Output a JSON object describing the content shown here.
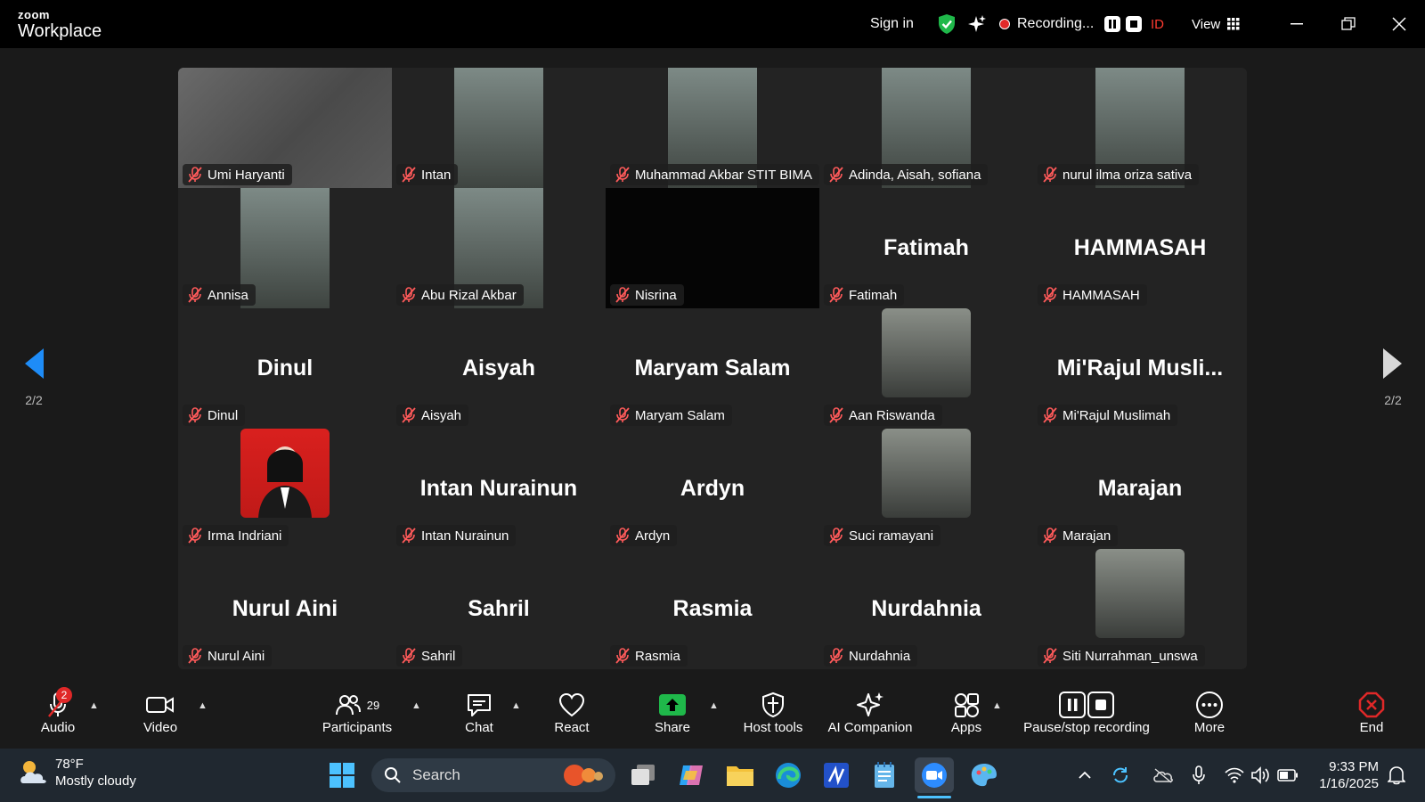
{
  "app": {
    "logo_top": "zoom",
    "logo_bottom": "Workplace"
  },
  "topbar": {
    "sign_in": "Sign in",
    "recording_label": "Recording...",
    "id_label": "ID",
    "view_label": "View"
  },
  "pager": {
    "left": "2/2",
    "right": "2/2"
  },
  "participants": [
    {
      "name": "Umi Haryanti",
      "display": "",
      "video": "blur"
    },
    {
      "name": "Intan",
      "display": "",
      "video": "cam"
    },
    {
      "name": "Muhammad Akbar STIT BIMA",
      "display": "",
      "video": "cam"
    },
    {
      "name": "Adinda, Aisah, sofiana",
      "display": "",
      "video": "cam"
    },
    {
      "name": "nurul ilma oriza sativa",
      "display": "",
      "video": "cam"
    },
    {
      "name": "Annisa",
      "display": "",
      "video": "cam"
    },
    {
      "name": "Abu Rizal Akbar",
      "display": "",
      "video": "cam"
    },
    {
      "name": "Nisrina",
      "display": "",
      "video": "dark"
    },
    {
      "name": "Fatimah",
      "display": "Fatimah",
      "video": "none"
    },
    {
      "name": "HAMMASAH",
      "display": "HAMMASAH",
      "video": "none"
    },
    {
      "name": "Dinul",
      "display": "Dinul",
      "video": "none"
    },
    {
      "name": "Aisyah",
      "display": "Aisyah",
      "video": "none"
    },
    {
      "name": "Maryam Salam",
      "display": "Maryam Salam",
      "video": "none"
    },
    {
      "name": "Aan Riswanda",
      "display": "",
      "video": "photo"
    },
    {
      "name": "Mi'Rajul Muslimah",
      "display": "Mi'Rajul Musli...",
      "video": "none"
    },
    {
      "name": "Irma Indriani",
      "display": "",
      "video": "photo-red"
    },
    {
      "name": "Intan Nurainun",
      "display": "Intan Nurainun",
      "video": "none"
    },
    {
      "name": "Ardyn",
      "display": "Ardyn",
      "video": "none"
    },
    {
      "name": "Suci ramayani",
      "display": "",
      "video": "photo"
    },
    {
      "name": "Marajan",
      "display": "Marajan",
      "video": "none"
    },
    {
      "name": "Nurul Aini",
      "display": "Nurul Aini",
      "video": "none"
    },
    {
      "name": "Sahril",
      "display": "Sahril",
      "video": "none"
    },
    {
      "name": "Rasmia",
      "display": "Rasmia",
      "video": "none"
    },
    {
      "name": "Nurdahnia",
      "display": "Nurdahnia",
      "video": "none"
    },
    {
      "name": "Siti Nurrahman_unswa",
      "display": "",
      "video": "photo"
    }
  ],
  "toolbar": {
    "audio": "Audio",
    "video": "Video",
    "participants": "Participants",
    "participants_count": "29",
    "chat": "Chat",
    "react": "React",
    "share": "Share",
    "host_tools": "Host tools",
    "ai_companion": "AI Companion",
    "apps": "Apps",
    "pause_stop": "Pause/stop recording",
    "more": "More",
    "end": "End",
    "audio_badge": "2"
  },
  "taskbar": {
    "weather_temp": "78°F",
    "weather_desc": "Mostly cloudy",
    "search_placeholder": "Search",
    "time": "9:33 PM",
    "date": "1/16/2025"
  },
  "colors": {
    "accent_green": "#1fb84a",
    "recording_red": "#e02828",
    "id_red": "#ff3b30"
  }
}
